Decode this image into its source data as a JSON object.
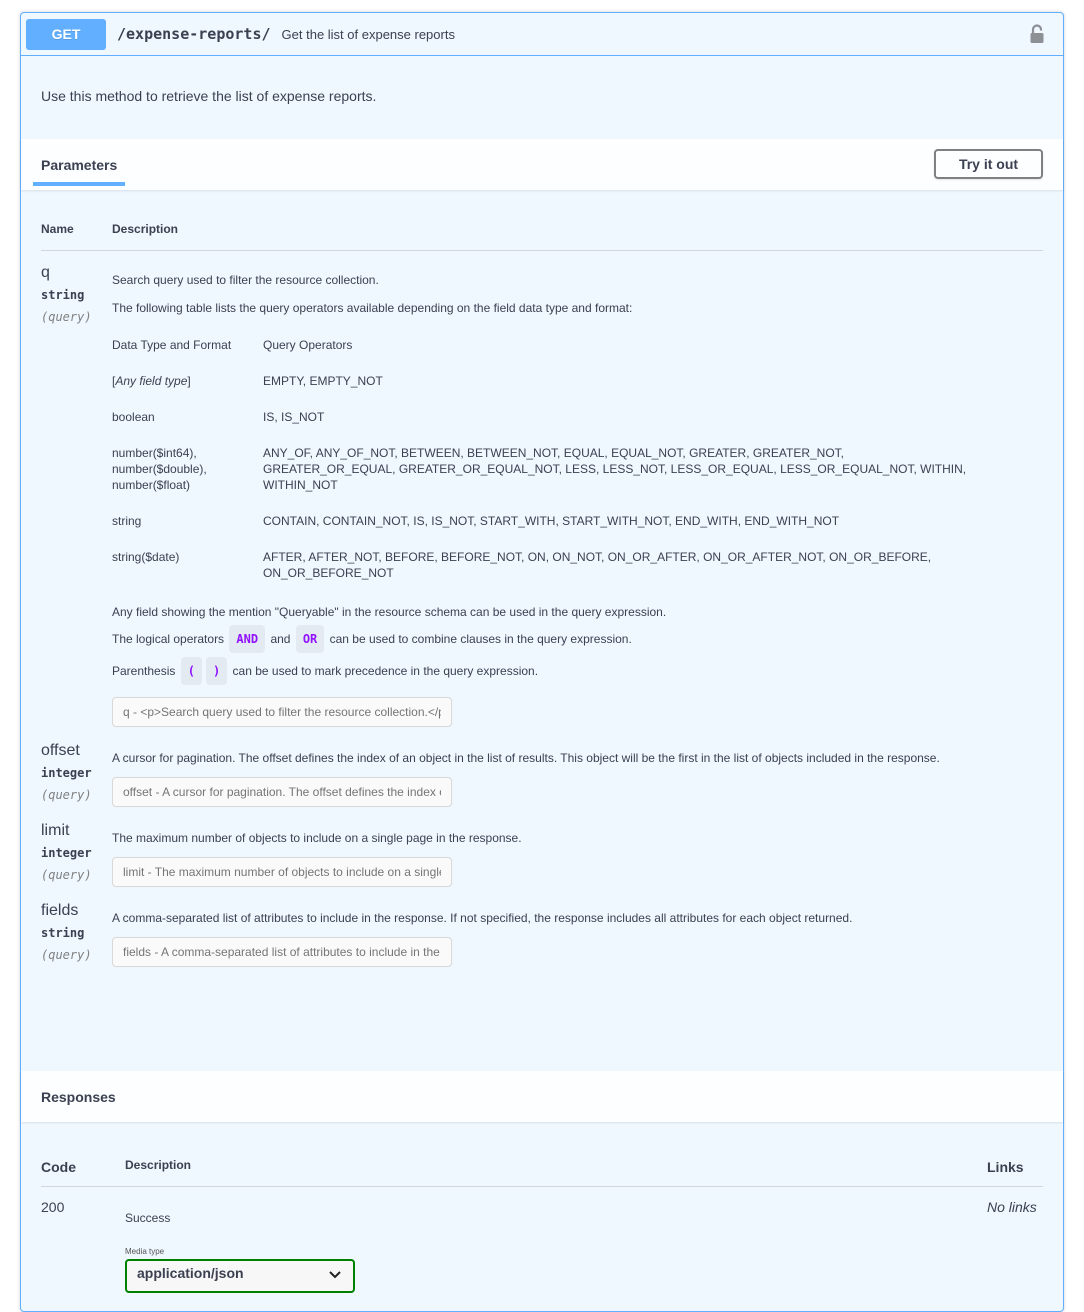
{
  "operation": {
    "method": "GET",
    "path": "/expense-reports/",
    "summary": "Get the list of expense reports",
    "description": "Use this method to retrieve the list of expense reports.",
    "lock_icon": "unlocked-padlock-icon"
  },
  "parameters_section": {
    "tab_label": "Parameters",
    "try_it_out_label": "Try it out",
    "column_headers": {
      "name": "Name",
      "description": "Description"
    }
  },
  "parameters": [
    {
      "name": "q",
      "type": "string",
      "in": "(query)",
      "description_lines": [
        "Search query used to filter the resource collection.",
        "The following table lists the query operators available depending on the field data type and format:"
      ],
      "operators_table": {
        "headers": [
          "Data Type and Format",
          "Query Operators"
        ],
        "rows": [
          {
            "type_prefix": "[",
            "type_italic": "Any field type",
            "type_suffix": "]",
            "operators": "EMPTY, EMPTY_NOT"
          },
          {
            "type": "boolean",
            "operators": "IS, IS_NOT"
          },
          {
            "type_lines": [
              "number($int64),",
              "number($double),",
              "number($float)"
            ],
            "operators": "ANY_OF, ANY_OF_NOT, BETWEEN, BETWEEN_NOT, EQUAL, EQUAL_NOT, GREATER, GREATER_NOT, GREATER_OR_EQUAL, GREATER_OR_EQUAL_NOT, LESS, LESS_NOT, LESS_OR_EQUAL, LESS_OR_EQUAL_NOT, WITHIN, WITHIN_NOT"
          },
          {
            "type": "string",
            "operators": "CONTAIN, CONTAIN_NOT, IS, IS_NOT, START_WITH, START_WITH_NOT, END_WITH, END_WITH_NOT"
          },
          {
            "type": "string($date)",
            "operators": "AFTER, AFTER_NOT, BEFORE, BEFORE_NOT, ON, ON_NOT, ON_OR_AFTER, ON_OR_AFTER_NOT, ON_OR_BEFORE, ON_OR_BEFORE_NOT"
          }
        ]
      },
      "queryable_note": "Any field showing the mention \"Queryable\" in the resource schema can be used in the query expression.",
      "logical_note": {
        "prefix": "The logical operators",
        "op1": "AND",
        "middle": "and",
        "op2": "OR",
        "suffix": "can be used to combine clauses in the query expression."
      },
      "paren_note": {
        "prefix": "Parenthesis",
        "open": "(",
        "close": ")",
        "suffix": "can be used to mark precedence in the query expression."
      },
      "input_placeholder": "q - <p>Search query used to filter the resource collection.</p>"
    },
    {
      "name": "offset",
      "type": "integer",
      "in": "(query)",
      "description": "A cursor for pagination. The offset defines the index of an object in the list of results. This object will be the first in the list of objects included in the response.",
      "input_placeholder": "offset - A cursor for pagination. The offset defines the index of an object in the list of results."
    },
    {
      "name": "limit",
      "type": "integer",
      "in": "(query)",
      "description": "The maximum number of objects to include on a single page in the response.",
      "input_placeholder": "limit - The maximum number of objects to include on a single page in the response."
    },
    {
      "name": "fields",
      "type": "string",
      "in": "(query)",
      "description": "A comma-separated list of attributes to include in the response. If not specified, the response includes all attributes for each object returned.",
      "input_placeholder": "fields - A comma-separated list of attributes to include in the response."
    }
  ],
  "responses_section": {
    "title": "Responses",
    "column_headers": {
      "code": "Code",
      "description": "Description",
      "links": "Links"
    },
    "rows": [
      {
        "code": "200",
        "description": "Success",
        "links": "No links",
        "media_type_label": "Media type",
        "media_type_value": "application/json"
      }
    ]
  },
  "colors": {
    "get_accent": "#61affe",
    "block_background": "#eff7ff",
    "chip_text": "#9012fe",
    "media_select_border": "#008000"
  }
}
